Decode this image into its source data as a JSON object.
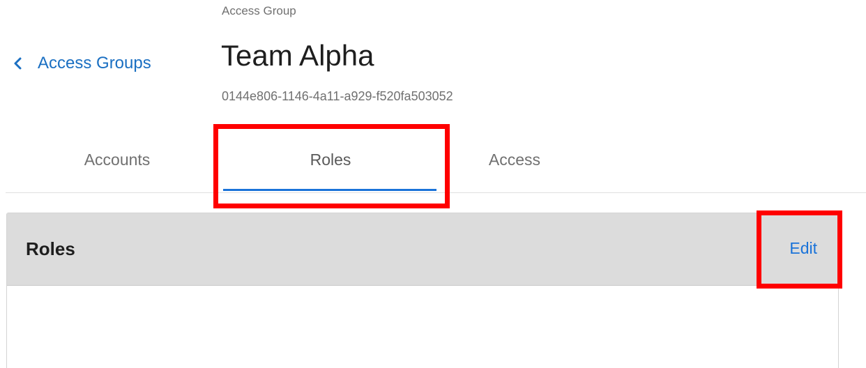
{
  "nav": {
    "back_label": "Access Groups"
  },
  "header": {
    "eyebrow": "Access Group",
    "title": "Team Alpha",
    "id": "0144e806-1146-4a11-a929-f520fa503052"
  },
  "tabs": [
    {
      "label": "Accounts",
      "selected": false
    },
    {
      "label": "Roles",
      "selected": true
    },
    {
      "label": "Access",
      "selected": false
    }
  ],
  "panel": {
    "title": "Roles",
    "edit_label": "Edit"
  },
  "colors": {
    "link": "#1a6fc2",
    "accent": "#1a73d9",
    "highlight": "#ff0000",
    "panel_header_bg": "#dcdcdc"
  },
  "icons": {
    "back": "chevron-left-icon"
  }
}
